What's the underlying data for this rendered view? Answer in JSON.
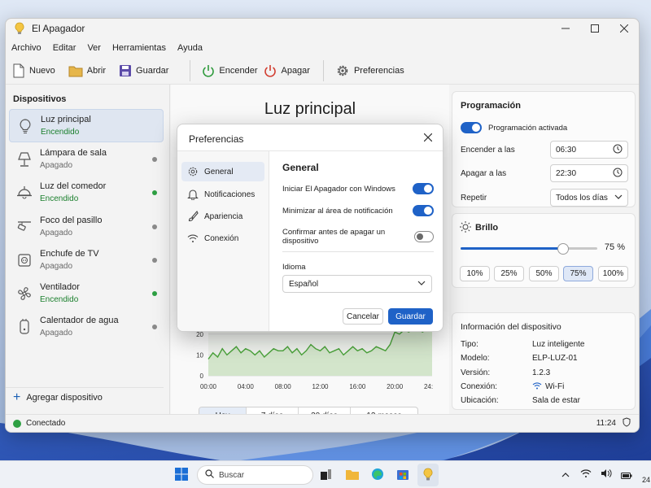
{
  "window": {
    "title": "El Apagador"
  },
  "menu": [
    "Archivo",
    "Editar",
    "Ver",
    "Herramientas",
    "Ayuda"
  ],
  "toolbar": {
    "nuevo": "Nuevo",
    "abrir": "Abrir",
    "guardar": "Guardar",
    "encender": "Encender",
    "apagar": "Apagar",
    "preferencias": "Preferencias"
  },
  "sidebar": {
    "heading": "Dispositivos",
    "add": "Agregar dispositivo",
    "items": [
      {
        "name": "Luz principal",
        "status": "Encendido",
        "on": true,
        "icon": "bulb-icon"
      },
      {
        "name": "Lámpara de sala",
        "status": "Apagado",
        "on": false,
        "icon": "lamp-icon"
      },
      {
        "name": "Luz del comedor",
        "status": "Encendido",
        "on": true,
        "icon": "ceiling-lamp-icon"
      },
      {
        "name": "Foco del pasillo",
        "status": "Apagado",
        "on": false,
        "icon": "track-light-icon"
      },
      {
        "name": "Enchufe de TV",
        "status": "Apagado",
        "on": false,
        "icon": "plug-icon"
      },
      {
        "name": "Ventilador",
        "status": "Encendido",
        "on": true,
        "icon": "fan-icon"
      },
      {
        "name": "Calentador de agua",
        "status": "Apagado",
        "on": false,
        "icon": "water-heater-icon"
      }
    ]
  },
  "main": {
    "title": "Luz principal",
    "ranges": [
      "Hoy",
      "7 días",
      "30 días",
      "12 meses"
    ],
    "active_range": "Hoy"
  },
  "chart_data": {
    "type": "area",
    "x_ticks": [
      "00:00",
      "04:00",
      "08:00",
      "12:00",
      "16:00",
      "20:00",
      "24:00"
    ],
    "y_ticks": [
      0,
      10,
      20
    ],
    "ylim": [
      0,
      25
    ],
    "x": [
      0,
      0.5,
      1,
      1.5,
      2,
      2.5,
      3,
      3.5,
      4,
      4.5,
      5,
      5.5,
      6,
      6.5,
      7,
      7.5,
      8,
      8.5,
      9,
      9.5,
      10,
      10.5,
      11,
      11.5,
      12,
      12.5,
      13,
      13.5,
      14,
      14.5,
      15,
      15.5,
      16,
      16.5,
      17,
      17.5,
      18,
      18.5,
      19,
      19.5,
      20,
      20.5,
      21,
      21.5,
      22,
      22.5,
      23,
      23.5,
      24
    ],
    "values": [
      8,
      11,
      9,
      13,
      10,
      12,
      14,
      11,
      13,
      12,
      10,
      12,
      9,
      11,
      13,
      12,
      12,
      14,
      11,
      13,
      10,
      12,
      15,
      13,
      12,
      14,
      11,
      12,
      13,
      10,
      12,
      14,
      12,
      13,
      11,
      12,
      14,
      13,
      12,
      15,
      21,
      20,
      22,
      21,
      23,
      22,
      21,
      23,
      22
    ]
  },
  "schedule": {
    "heading": "Programación",
    "toggle_label": "Programación activada",
    "on_label": "Encender a las",
    "on_time": "06:30",
    "off_label": "Apagar a las",
    "off_time": "22:30",
    "repeat_label": "Repetir",
    "repeat_value": "Todos los días"
  },
  "brightness": {
    "heading": "Brillo",
    "value": 75,
    "value_text": "75 %",
    "presets": [
      "10%",
      "25%",
      "50%",
      "75%",
      "100%"
    ],
    "active": "75%"
  },
  "info": {
    "heading": "Información del dispositivo",
    "rows": [
      {
        "label": "Tipo:",
        "value": "Luz inteligente"
      },
      {
        "label": "Modelo:",
        "value": "ELP-LUZ-01"
      },
      {
        "label": "Versión:",
        "value": "1.2.3"
      },
      {
        "label": "Conexión:",
        "value": "Wi-Fi"
      },
      {
        "label": "Ubicación:",
        "value": "Sala de estar"
      }
    ]
  },
  "status": {
    "text": "Conectado",
    "time": "11:24"
  },
  "prefs": {
    "title": "Preferencias",
    "nav": [
      "General",
      "Notificaciones",
      "Apariencia",
      "Conexión"
    ],
    "section": "General",
    "options": [
      {
        "label": "Iniciar El Apagador con Windows",
        "on": true
      },
      {
        "label": "Minimizar al área de notificación",
        "on": true
      },
      {
        "label": "Confirmar antes de apagar un dispositivo",
        "on": false
      }
    ],
    "language_label": "Idioma",
    "language": "Español",
    "cancel": "Cancelar",
    "save": "Guardar"
  },
  "taskbar": {
    "search": "Buscar",
    "clock": "24"
  },
  "colors": {
    "accent": "#1f62c7",
    "on": "#2ea043",
    "off": "#8a8a8a"
  }
}
